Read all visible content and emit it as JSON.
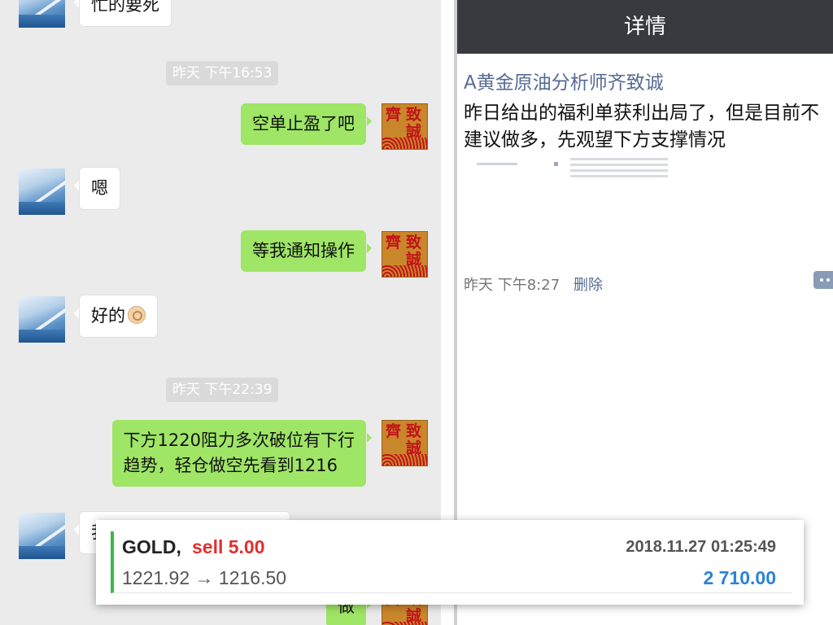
{
  "chat": {
    "seal_chars": [
      "齊",
      "致",
      "誠"
    ],
    "messages": [
      {
        "side": "in",
        "text": "忙的要死"
      },
      {
        "type": "time",
        "text": "昨天 下午16:53"
      },
      {
        "side": "out",
        "text": "空单止盈了吧"
      },
      {
        "side": "in",
        "text": "嗯"
      },
      {
        "side": "out",
        "text": "等我通知操作"
      },
      {
        "side": "in",
        "text": "好的",
        "emoji": "ok-hand-emoji"
      },
      {
        "type": "time",
        "text": "昨天 下午22:39"
      },
      {
        "side": "out",
        "text": "下方1220阻力多次破位有下行\n趋势，轻仓做空先看到1216"
      },
      {
        "side": "in",
        "text": "我"
      },
      {
        "side": "out",
        "text": "做"
      }
    ]
  },
  "detail": {
    "title": "详情",
    "author": "A黄金原油分析师齐致诚",
    "text": "昨日给出的福利单获利出局了，但是目前不建议做多，先观望下方支撑情况",
    "time": "昨天 下午8:27",
    "delete_label": "删除",
    "comment_icon": "comment-icon"
  },
  "trade": {
    "symbol": "GOLD,",
    "side": "sell 5.00",
    "datetime": "2018.11.27 01:25:49",
    "prices": "1221.92 → 1216.50",
    "profit": "2 710.00",
    "colors": {
      "side": "#e0302f",
      "profit": "#2a83d8",
      "accent": "#3cb84a"
    }
  }
}
